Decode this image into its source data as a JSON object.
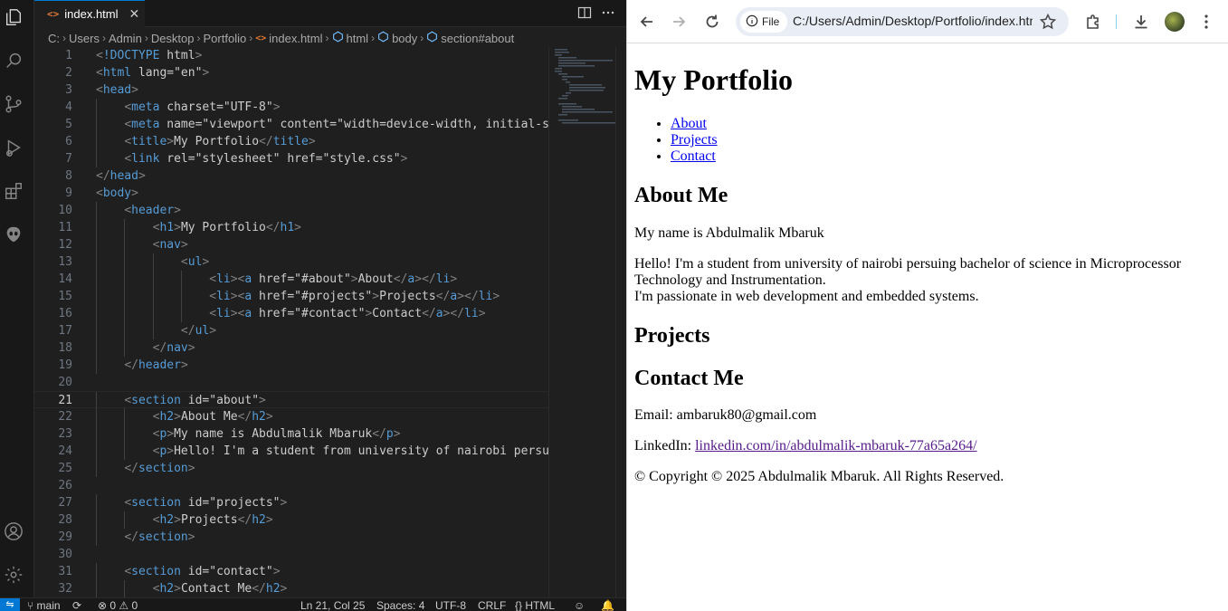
{
  "editor": {
    "tab_label": "index.html",
    "breadcrumb": [
      "C:",
      "Users",
      "Admin",
      "Desktop",
      "Portfolio",
      "index.html",
      "html",
      "body",
      "section#about"
    ],
    "lines": [
      {
        "n": "1",
        "code": "<!DOCTYPE html>"
      },
      {
        "n": "2",
        "code": "<html lang=\"en\">"
      },
      {
        "n": "3",
        "code": "<head>"
      },
      {
        "n": "4",
        "code": "    <meta charset=\"UTF-8\">"
      },
      {
        "n": "5",
        "code": "    <meta name=\"viewport\" content=\"width=device-width, initial-sc"
      },
      {
        "n": "6",
        "code": "    <title>My Portfolio</title>"
      },
      {
        "n": "7",
        "code": "    <link rel=\"stylesheet\" href=\"style.css\">"
      },
      {
        "n": "8",
        "code": "</head>"
      },
      {
        "n": "9",
        "code": "<body>"
      },
      {
        "n": "10",
        "code": "    <header>"
      },
      {
        "n": "11",
        "code": "        <h1>My Portfolio</h1>"
      },
      {
        "n": "12",
        "code": "        <nav>"
      },
      {
        "n": "13",
        "code": "            <ul>"
      },
      {
        "n": "14",
        "code": "                <li><a href=\"#about\">About</a></li>"
      },
      {
        "n": "15",
        "code": "                <li><a href=\"#projects\">Projects</a></li>"
      },
      {
        "n": "16",
        "code": "                <li><a href=\"#contact\">Contact</a></li>"
      },
      {
        "n": "17",
        "code": "            </ul>"
      },
      {
        "n": "18",
        "code": "        </nav>"
      },
      {
        "n": "19",
        "code": "    </header>"
      },
      {
        "n": "20",
        "code": ""
      },
      {
        "n": "21",
        "code": "    <section id=\"about\">"
      },
      {
        "n": "22",
        "code": "        <h2>About Me</h2>"
      },
      {
        "n": "23",
        "code": "        <p>My name is Abdulmalik Mbaruk</p>"
      },
      {
        "n": "24",
        "code": "        <p>Hello! I'm a student from university of nairobi persui"
      },
      {
        "n": "25",
        "code": "    </section>"
      },
      {
        "n": "26",
        "code": ""
      },
      {
        "n": "27",
        "code": "    <section id=\"projects\">"
      },
      {
        "n": "28",
        "code": "        <h2>Projects</h2>"
      },
      {
        "n": "29",
        "code": "    </section>"
      },
      {
        "n": "30",
        "code": ""
      },
      {
        "n": "31",
        "code": "    <section id=\"contact\">"
      },
      {
        "n": "32",
        "code": "        <h2>Contact Me</h2>"
      }
    ],
    "active_line": "21"
  },
  "status_bar": {
    "branch": "main",
    "problems": "0",
    "warnings": "0",
    "cursor": "Ln 21, Col 25",
    "spaces": "Spaces: 4",
    "encoding": "UTF-8",
    "eol": "CRLF",
    "language": "HTML"
  },
  "browser": {
    "chip_label": "File",
    "url": "C:/Users/Admin/Desktop/Portfolio/index.html"
  },
  "page": {
    "title": "My Portfolio",
    "nav": [
      "About",
      "Projects",
      "Contact"
    ],
    "about_heading": "About Me",
    "about_name": "My name is Abdulmalik Mbaruk",
    "about_bio_1": "Hello! I'm a student from university of nairobi persuing bachelor of science in Microprocessor",
    "about_bio_2": "Technology and Instrumentation.",
    "about_bio_3": "I'm passionate in web development and embedded systems.",
    "projects_heading": "Projects",
    "contact_heading": "Contact Me",
    "email_label": "Email: ambaruk80@gmail.com",
    "linkedin_label": "LinkedIn: ",
    "linkedin_link": "linkedin.com/in/abdulmalik-mbaruk-77a65a264/",
    "copyright": "© Copyright © 2025 Abdulmalik Mbaruk. All Rights Reserved."
  },
  "colors": {
    "accent": "#0078d4",
    "html_icon": "#e37933",
    "link": "#0000ee",
    "visited": "#551a8b"
  }
}
